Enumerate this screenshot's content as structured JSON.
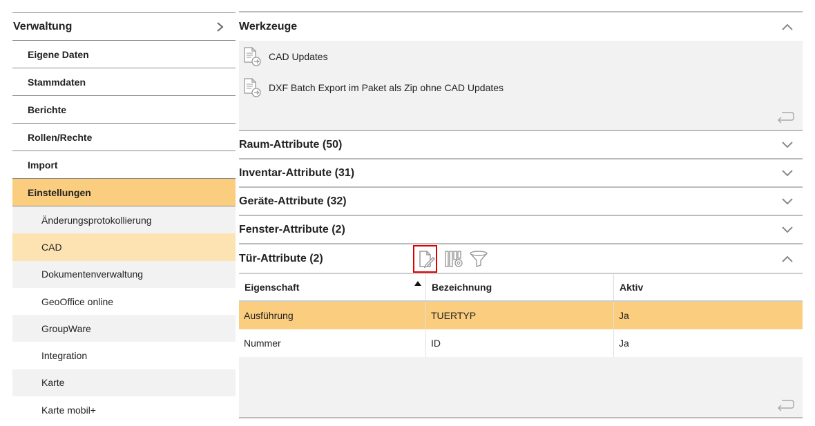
{
  "sidebar": {
    "title": "Verwaltung",
    "items": [
      {
        "label": "Eigene Daten"
      },
      {
        "label": "Stammdaten"
      },
      {
        "label": "Berichte"
      },
      {
        "label": "Rollen/Rechte"
      },
      {
        "label": "Import"
      },
      {
        "label": "Einstellungen"
      }
    ],
    "subitems": [
      {
        "label": "Änderungsprotokollierung"
      },
      {
        "label": "CAD"
      },
      {
        "label": "Dokumentenverwaltung"
      },
      {
        "label": "GeoOffice online"
      },
      {
        "label": "GroupWare"
      },
      {
        "label": "Integration"
      },
      {
        "label": "Karte"
      },
      {
        "label": "Karte mobil+"
      }
    ]
  },
  "main": {
    "tools": {
      "title": "Werkzeuge",
      "items": [
        {
          "label": "CAD Updates",
          "icon": "document-arrow-icon"
        },
        {
          "label": "DXF Batch Export im Paket als Zip ohne CAD Updates",
          "icon": "document-arrow-icon"
        }
      ]
    },
    "sections": [
      {
        "title": "Raum-Attribute (50)"
      },
      {
        "title": "Inventar-Attribute (31)"
      },
      {
        "title": "Geräte-Attribute (32)"
      },
      {
        "title": "Fenster-Attribute (2)"
      }
    ],
    "door": {
      "title": "Tür-Attribute (2)",
      "columns": [
        "Eigenschaft",
        "Bezeichnung",
        "Aktiv"
      ],
      "rows": [
        [
          "Ausführung",
          "TUERTYP",
          "Ja"
        ],
        [
          "Nummer",
          "ID",
          "Ja"
        ]
      ]
    }
  },
  "colors": {
    "accent": "#fbcd7f",
    "accent_light": "#fde3b2",
    "highlight_border": "#dd0000"
  }
}
